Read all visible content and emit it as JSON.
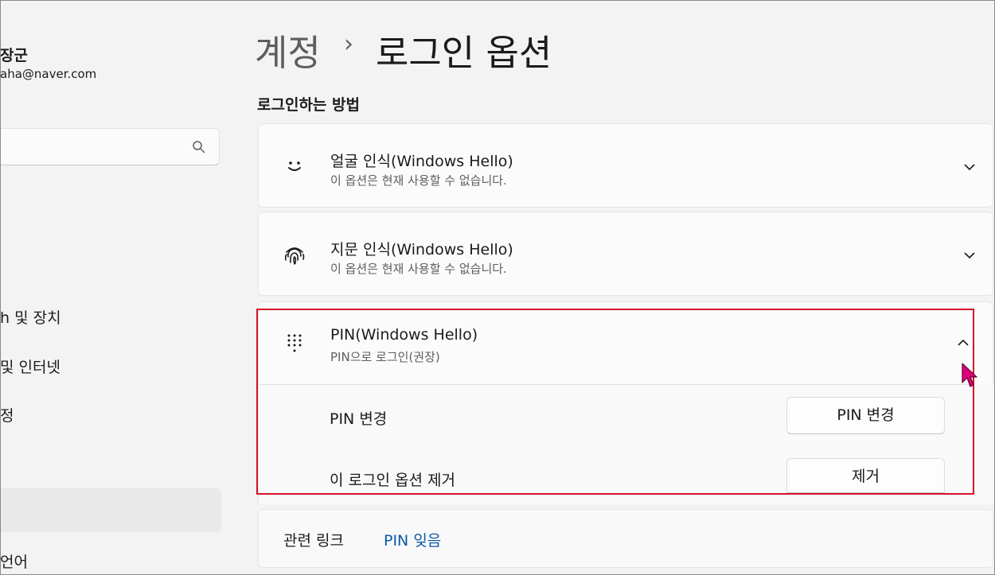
{
  "sidebar": {
    "user_name": "장군",
    "user_email": "aha@naver.com",
    "nav_items": [
      {
        "label": "h 및 장치"
      },
      {
        "label": " 및 인터넷"
      },
      {
        "label": "정"
      },
      {
        "label": ""
      },
      {
        "label": "언어"
      }
    ]
  },
  "header": {
    "breadcrumb_parent": "계정",
    "breadcrumb_separator": "›",
    "breadcrumb_current": "로그인 옵션"
  },
  "section": {
    "title": "로그인하는 방법"
  },
  "methods": [
    {
      "icon": "smile-face-icon",
      "title": "얼굴 인식(Windows Hello)",
      "subtitle": "이 옵션은 현재 사용할 수 없습니다.",
      "expanded": false
    },
    {
      "icon": "fingerprint-icon",
      "title": "지문 인식(Windows Hello)",
      "subtitle": "이 옵션은 현재 사용할 수 없습니다.",
      "expanded": false
    },
    {
      "icon": "keypad-icon",
      "title": "PIN(Windows Hello)",
      "subtitle": "PIN으로 로그인(권장)",
      "expanded": true,
      "rows": [
        {
          "label": "PIN 변경",
          "button": "PIN 변경"
        },
        {
          "label": "이 로그인 옵션 제거",
          "button": "제거"
        }
      ]
    }
  ],
  "related": {
    "label": "관련 링크",
    "link": "PIN 잊음"
  },
  "colors": {
    "background": "#f3f3f3",
    "card": "#fbfbfb",
    "highlight": "#d6122a",
    "link": "#0f5aa8",
    "cursor": "#e0007a"
  }
}
